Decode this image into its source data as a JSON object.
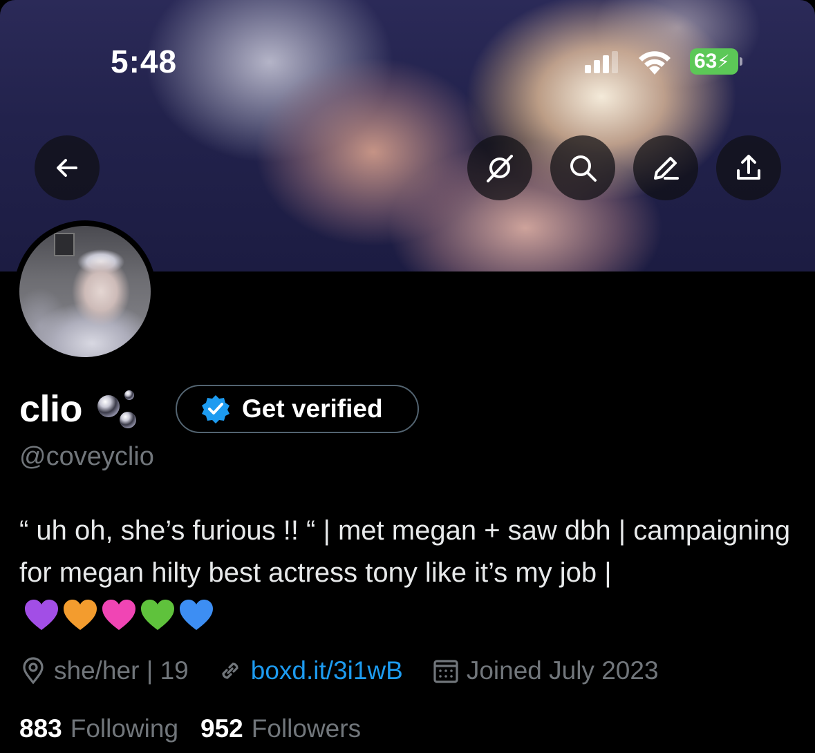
{
  "status_bar": {
    "time": "5:48",
    "battery": "63",
    "icons": [
      "signal-icon",
      "wifi-icon",
      "battery-charging-icon"
    ]
  },
  "header": {
    "buttons": [
      "back-arrow-icon",
      "grok-icon",
      "search-icon",
      "edit-icon",
      "share-icon"
    ]
  },
  "profile": {
    "display_name": "clio",
    "name_emoji": "bubbles",
    "verify_button": "Get verified",
    "handle": "@coveyclio",
    "bio_text": "“ uh oh, she’s furious !! “ | met megan + saw dbh | campaigning for megan hilty best actress tony like it’s my job |",
    "bio_hearts": [
      "purple",
      "orange",
      "pink",
      "green",
      "blue"
    ],
    "location": "she/her | 19",
    "website": "boxd.it/3i1wB",
    "joined": "Joined July 2023",
    "following_count": "883",
    "following_label": "Following",
    "followers_count": "952",
    "followers_label": "Followers"
  },
  "colors": {
    "background": "#000000",
    "secondary_text": "#71767b",
    "link": "#1d9bf0",
    "verify_badge": "#1d9bf0",
    "battery": "#5cc857"
  }
}
